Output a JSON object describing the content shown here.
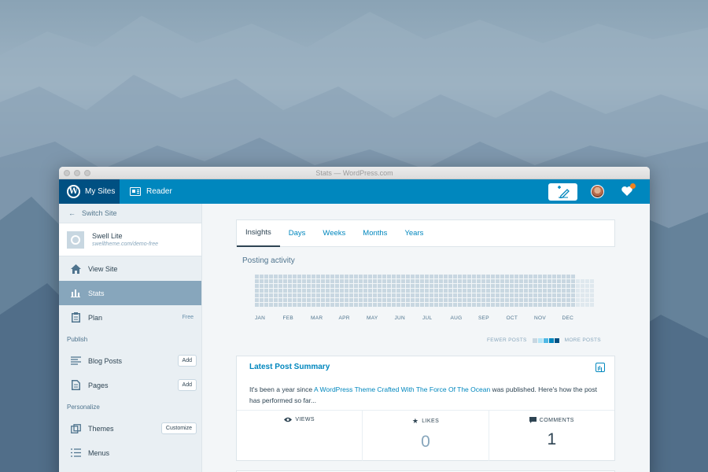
{
  "window": {
    "title": "Stats — WordPress.com"
  },
  "masterbar": {
    "my_sites": "My Sites",
    "reader": "Reader",
    "colors": {
      "bar": "#0087be",
      "active": "#005082",
      "notification_dot": "#f0821e"
    }
  },
  "sidebar": {
    "switch_site": "Switch Site",
    "site": {
      "name": "Swell Lite",
      "url": "swelltheme.com/demo-free"
    },
    "items": [
      {
        "label": "View Site",
        "icon": "home-icon"
      },
      {
        "label": "Stats",
        "icon": "bar-chart-icon",
        "active": true
      },
      {
        "label": "Plan",
        "icon": "clipboard-icon",
        "badge": "Free"
      }
    ],
    "publish": {
      "heading": "Publish",
      "items": [
        {
          "label": "Blog Posts",
          "icon": "posts-icon",
          "button": "Add"
        },
        {
          "label": "Pages",
          "icon": "page-icon",
          "button": "Add"
        }
      ]
    },
    "personalize": {
      "heading": "Personalize",
      "items": [
        {
          "label": "Themes",
          "icon": "themes-icon",
          "button": "Customize"
        },
        {
          "label": "Menus",
          "icon": "menus-icon"
        }
      ]
    }
  },
  "main": {
    "tabs": [
      {
        "label": "Insights",
        "active": true
      },
      {
        "label": "Days"
      },
      {
        "label": "Weeks"
      },
      {
        "label": "Months"
      },
      {
        "label": "Years"
      }
    ],
    "posting_activity": {
      "title": "Posting activity",
      "months": [
        "JAN",
        "FEB",
        "MAR",
        "APR",
        "MAY",
        "JUN",
        "JUL",
        "AUG",
        "SEP",
        "OCT",
        "NOV",
        "DEC"
      ],
      "legend": {
        "fewer": "FEWER POSTS",
        "more": "MORE POSTS",
        "colors": [
          "#c8d7e1",
          "#b2e5f7",
          "#51b9e5",
          "#0087be",
          "#005082"
        ]
      }
    },
    "latest_post": {
      "title": "Latest Post Summary",
      "text_before": "It's been a year since ",
      "link": "A WordPress Theme Crafted With The Force Of The Ocean",
      "text_after": " was published. Here's how the post has performed so far...",
      "stats": [
        {
          "label": "VIEWS",
          "icon": "eye-icon",
          "value": ""
        },
        {
          "label": "LIKES",
          "icon": "star-icon",
          "value": "0"
        },
        {
          "label": "COMMENTS",
          "icon": "comment-icon",
          "value": "1"
        }
      ]
    }
  }
}
